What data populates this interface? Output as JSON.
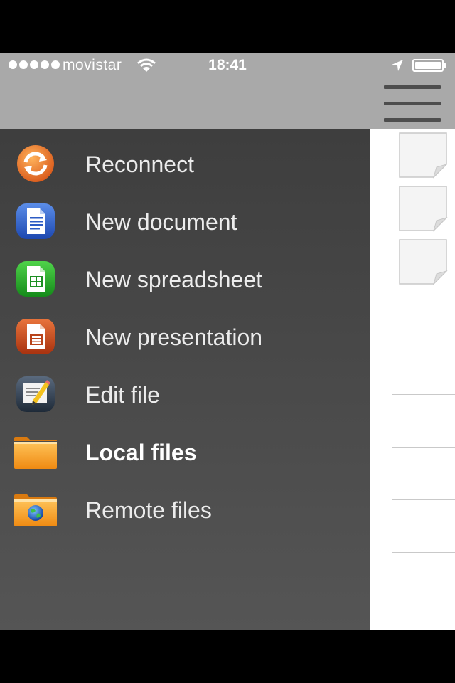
{
  "status_bar": {
    "carrier": "movistar",
    "time": "18:41",
    "signal_icon": "signal-dots-icon",
    "wifi_icon": "wifi-icon",
    "location_icon": "location-arrow-icon",
    "battery_icon": "battery-icon"
  },
  "nav": {
    "menu_icon": "hamburger-menu-icon"
  },
  "menu": {
    "items": [
      {
        "label": "Reconnect",
        "icon": "reconnect-icon"
      },
      {
        "label": "New document",
        "icon": "document-icon"
      },
      {
        "label": "New spreadsheet",
        "icon": "spreadsheet-icon"
      },
      {
        "label": "New presentation",
        "icon": "presentation-icon"
      },
      {
        "label": "Edit file",
        "icon": "edit-file-icon"
      },
      {
        "label": "Local files",
        "icon": "folder-icon",
        "active": true
      },
      {
        "label": "Remote files",
        "icon": "remote-folder-icon"
      }
    ]
  },
  "colors": {
    "status_bar_bg": "#a9a9a9",
    "menu_bg_top": "#3e3e3e",
    "menu_bg_bottom": "#555555",
    "menu_text": "#ececec"
  }
}
